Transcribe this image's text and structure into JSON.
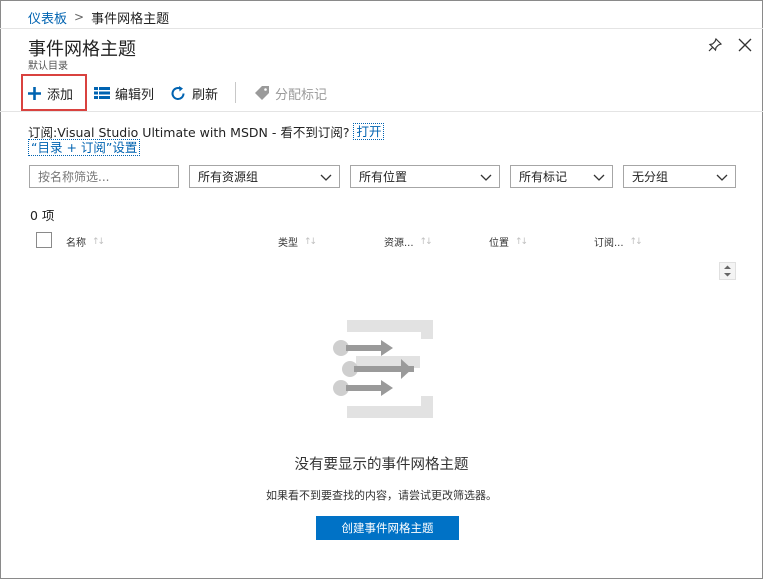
{
  "breadcrumb": {
    "home": "仪表板",
    "current": "事件网格主题"
  },
  "header": {
    "title": "事件网格主题",
    "subtitle": "默认目录"
  },
  "toolbar": {
    "add": "添加",
    "edit_columns": "编辑列",
    "refresh": "刷新",
    "assign_tags": "分配标记"
  },
  "subscription": {
    "text": "订阅:Visual Studio Ultimate with MSDN - 看不到订阅?",
    "open_link": "打开",
    "directory_link": "“目录 + 订阅”设置"
  },
  "filters": {
    "name_placeholder": "按名称筛选...",
    "resource_group": "所有资源组",
    "location": "所有位置",
    "tags": "所有标记",
    "grouping": "无分组"
  },
  "item_count": "0 项",
  "columns": [
    "名称",
    "类型",
    "资源...",
    "位置",
    "订阅..."
  ],
  "empty": {
    "title": "没有要显示的事件网格主题",
    "subtitle": "如果看不到要查找的内容，请尝试更改筛选器。",
    "create_button": "创建事件网格主题"
  },
  "colors": {
    "accent": "#0072c6",
    "link": "#0063b1",
    "highlight": "#d9423f"
  }
}
